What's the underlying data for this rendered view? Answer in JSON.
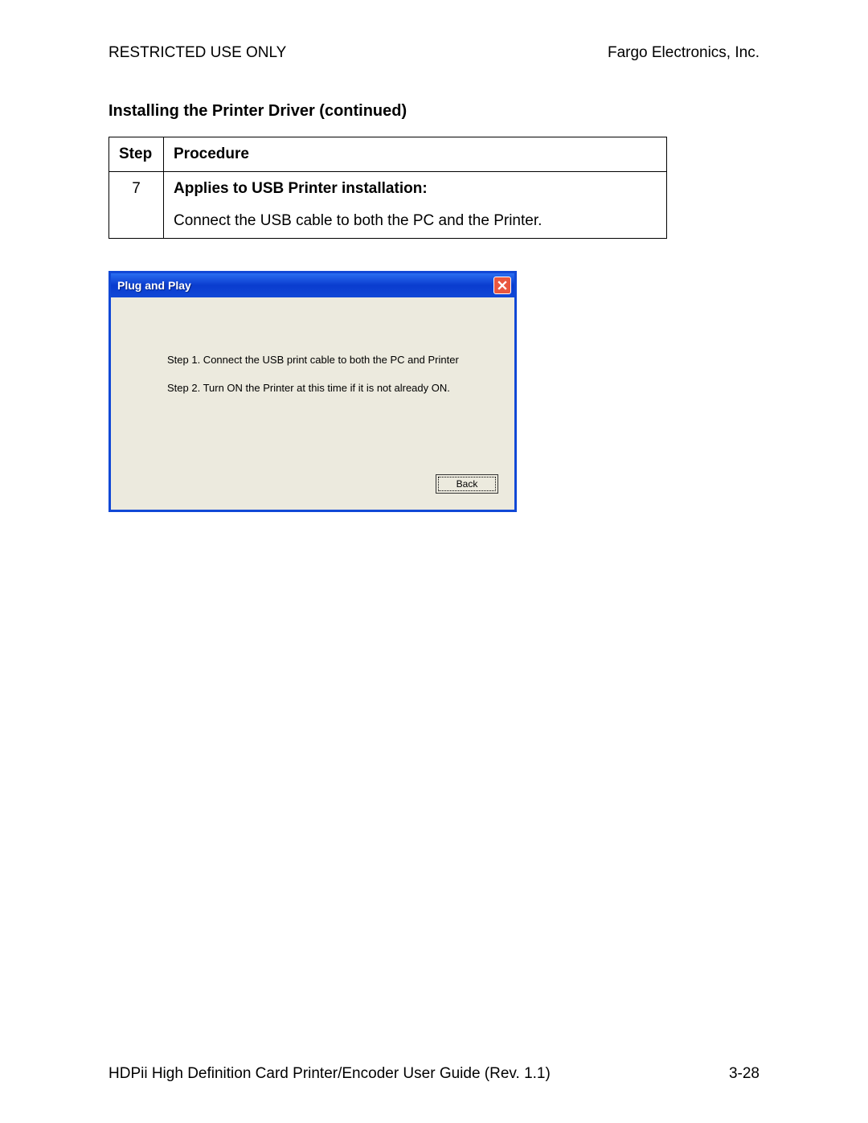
{
  "header": {
    "left": "RESTRICTED USE ONLY",
    "right": "Fargo Electronics, Inc."
  },
  "section_title": "Installing the Printer Driver (continued)",
  "table": {
    "head_step": "Step",
    "head_proc": "Procedure",
    "row": {
      "step": "7",
      "bold": "Applies to USB Printer installation:",
      "text": "Connect the USB cable to both the PC and the Printer."
    }
  },
  "dialog": {
    "title": "Plug and Play",
    "step1": "Step 1.  Connect the USB print cable to both the PC and Printer",
    "step2": "Step 2.  Turn ON the Printer at this time if it is not already ON.",
    "back_label": "Back"
  },
  "footer": {
    "left": "HDPii High Definition Card Printer/Encoder User Guide (Rev. 1.1)",
    "right": "3-28"
  }
}
